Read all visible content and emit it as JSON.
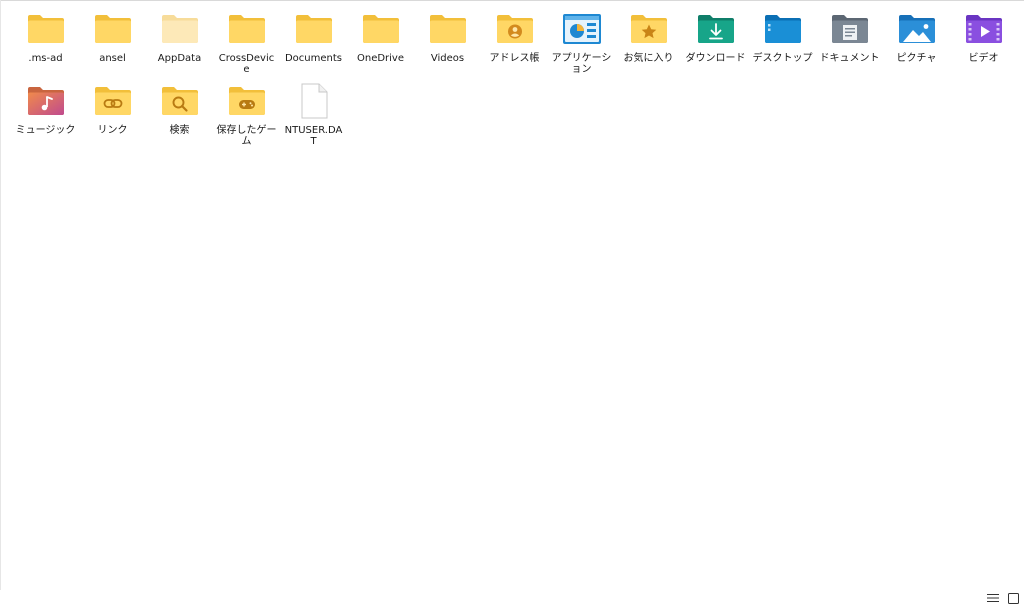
{
  "files": {
    "row1": [
      {
        "label": ".ms-ad",
        "icon": "folder-icon"
      },
      {
        "label": "ansel",
        "icon": "folder-icon"
      },
      {
        "label": "AppData",
        "icon": "folder-hidden-icon"
      },
      {
        "label": "CrossDevice",
        "icon": "folder-icon"
      },
      {
        "label": "Documents",
        "icon": "folder-icon"
      },
      {
        "label": "OneDrive",
        "icon": "folder-icon"
      },
      {
        "label": "Videos",
        "icon": "folder-icon"
      },
      {
        "label": "アドレス帳",
        "icon": "contacts-folder-icon"
      },
      {
        "label": "アプリケーション",
        "icon": "applications-icon"
      },
      {
        "label": "お気に入り",
        "icon": "favorites-folder-icon"
      },
      {
        "label": "ダウンロード",
        "icon": "downloads-folder-icon"
      },
      {
        "label": "デスクトップ",
        "icon": "desktop-folder-icon"
      },
      {
        "label": "ドキュメント",
        "icon": "documents-folder-icon"
      },
      {
        "label": "ピクチャ",
        "icon": "pictures-folder-icon"
      },
      {
        "label": "ビデオ",
        "icon": "videos-folder-icon"
      }
    ],
    "row2": [
      {
        "label": "ミュージック",
        "icon": "music-folder-icon"
      },
      {
        "label": "リンク",
        "icon": "links-folder-icon"
      },
      {
        "label": "検索",
        "icon": "searches-folder-icon"
      },
      {
        "label": "保存したゲーム",
        "icon": "saved-games-folder-icon"
      },
      {
        "label": "NTUSER.DAT",
        "icon": "file-icon"
      }
    ]
  },
  "colors": {
    "folder_back": "#f2bf3a",
    "folder_front": "#ffd765",
    "hidden_back": "#f7dc9a",
    "hidden_front": "#fde9b8",
    "downloads": "#17a589",
    "desktop": "#1a8fd6",
    "documents": "#7b8794",
    "pictures": "#2b8fd8",
    "videos": "#8a4fe0"
  }
}
